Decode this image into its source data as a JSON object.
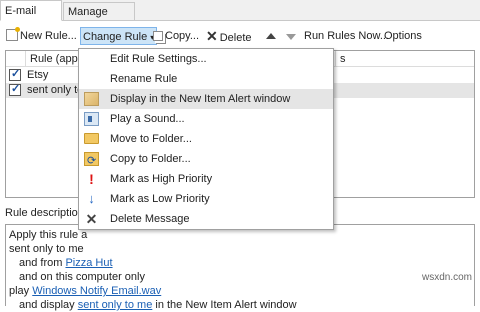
{
  "tabs": [
    {
      "label": "E-mail Rules"
    },
    {
      "label": "Manage Alerts"
    }
  ],
  "toolbar": {
    "new_rule": "New Rule...",
    "change_rule": "Change Rule",
    "copy": "Copy...",
    "delete": "Delete",
    "run_rules": "Run Rules Now...",
    "options": "Options"
  },
  "rules_list": {
    "col1_header": "Rule (applied",
    "col2_header": "s",
    "rows": [
      {
        "name": "Etsy",
        "checked": true
      },
      {
        "name": "sent only to",
        "checked": true
      }
    ]
  },
  "menu": {
    "items": [
      {
        "label": "Edit Rule Settings...",
        "icon": "none"
      },
      {
        "label": "Rename Rule",
        "icon": "none"
      },
      {
        "label": "Display in the New Item Alert window",
        "icon": "alert-window-icon"
      },
      {
        "label": "Play a Sound...",
        "icon": "speaker-icon"
      },
      {
        "label": "Move to Folder...",
        "icon": "folder-icon"
      },
      {
        "label": "Copy to Folder...",
        "icon": "copy-folder-icon"
      },
      {
        "label": "Mark as High Priority",
        "icon": "high-priority-icon"
      },
      {
        "label": "Mark as Low Priority",
        "icon": "low-priority-icon"
      },
      {
        "label": "Delete Message",
        "icon": "delete-icon"
      }
    ]
  },
  "description": {
    "label": "Rule description",
    "line1": "Apply this rule a",
    "line2": "sent only to me",
    "line3_prefix": "and from ",
    "line3_link": "Pizza Hut",
    "line4": "and on this computer only",
    "line5_prefix": "play ",
    "line5_link": "Windows Notify Email.wav",
    "line6_prefix": "and display ",
    "line6_link": "sent only to me",
    "line6_suffix": " in the New Item Alert window"
  },
  "watermark": "wsxdn.com",
  "colors": {
    "selection": "#cce4f7",
    "link": "#1a5fb4",
    "high_priority": "#dd1111",
    "low_priority": "#2a6ac4"
  }
}
